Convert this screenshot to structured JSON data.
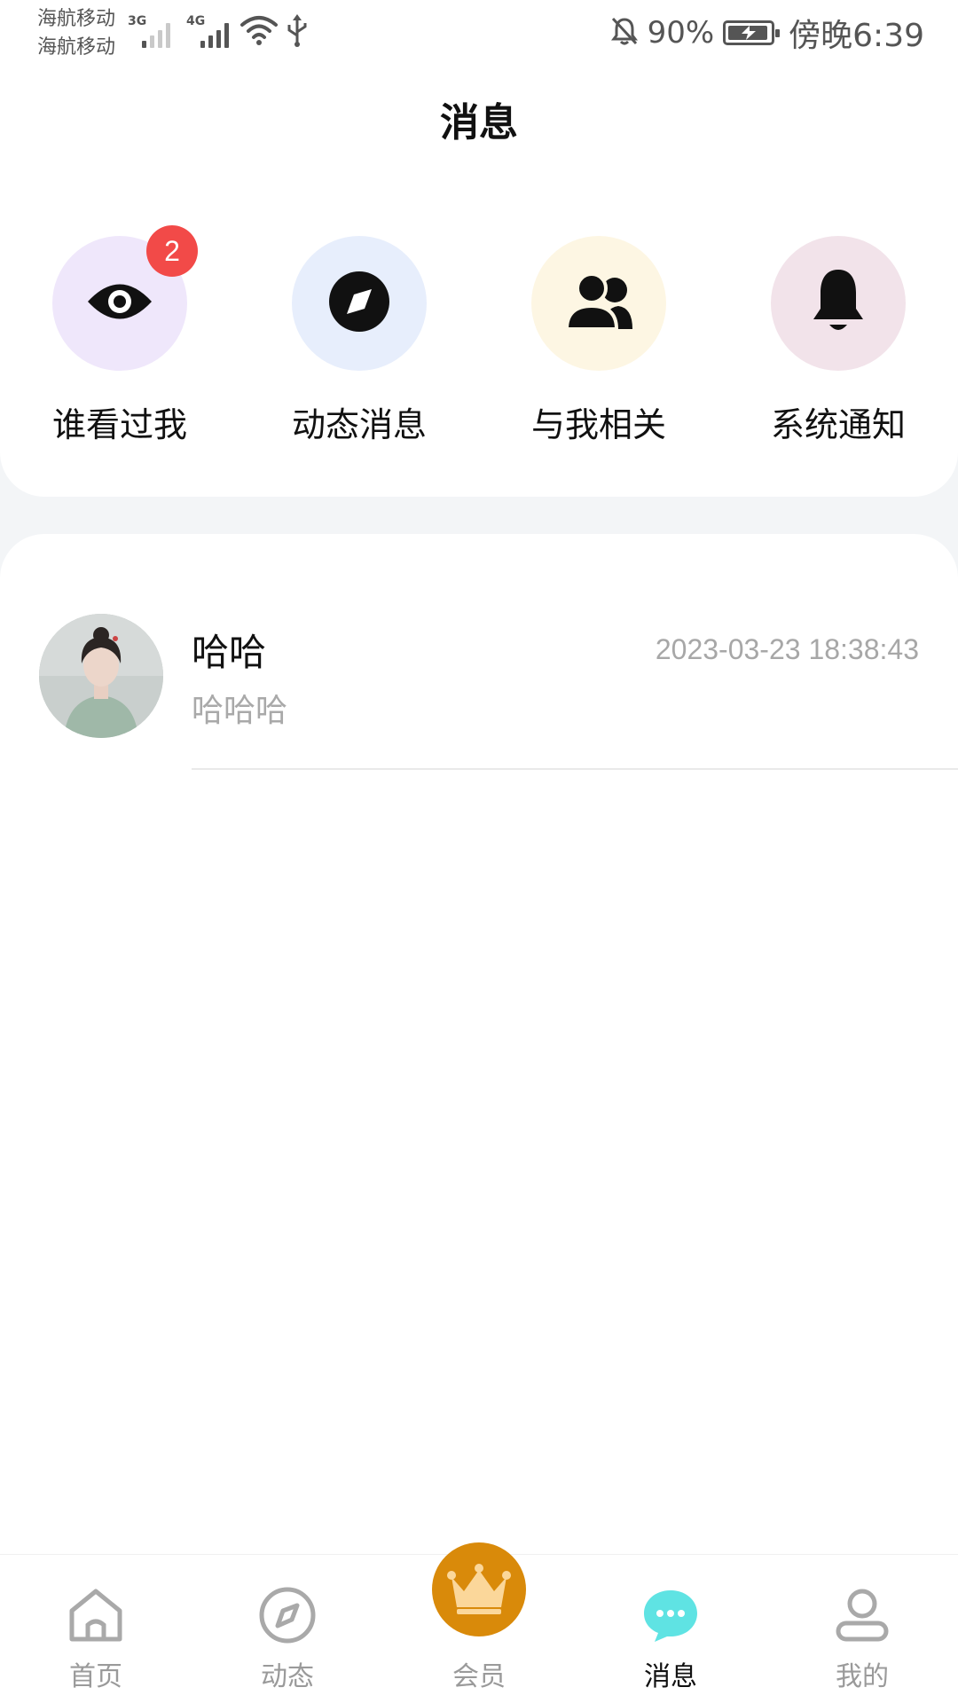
{
  "status_bar": {
    "carrier_1": "海航移动",
    "carrier_2": "海航移动",
    "network_1": "3G",
    "network_2": "4G",
    "battery_percent": "90%",
    "time": "傍晚6:39",
    "icons": [
      "signal-icon",
      "wifi-icon",
      "usb-icon",
      "mute-bell-icon",
      "battery-charging-icon"
    ]
  },
  "header": {
    "title": "消息"
  },
  "shortcuts": [
    {
      "label": "谁看过我",
      "icon": "eye-icon",
      "badge": "2",
      "bg": "#efe7fb"
    },
    {
      "label": "动态消息",
      "icon": "compass-icon",
      "bg": "#e7eefc"
    },
    {
      "label": "与我相关",
      "icon": "users-icon",
      "bg": "#fdf6e3"
    },
    {
      "label": "系统通知",
      "icon": "bell-icon",
      "bg": "#f2e3ea"
    }
  ],
  "messages": [
    {
      "name": "哈哈",
      "time": "2023-03-23 18:38:43",
      "preview": "哈哈哈"
    }
  ],
  "bottom_nav": {
    "items": [
      {
        "label": "首页",
        "icon": "home-icon"
      },
      {
        "label": "动态",
        "icon": "compass-icon"
      },
      {
        "label": "会员",
        "icon": "crown-icon"
      },
      {
        "label": "消息",
        "icon": "chat-bubble-icon",
        "active": true
      },
      {
        "label": "我的",
        "icon": "user-icon"
      }
    ],
    "accent_color": "#5fe3e3",
    "vip_color": "#d98a0a"
  }
}
